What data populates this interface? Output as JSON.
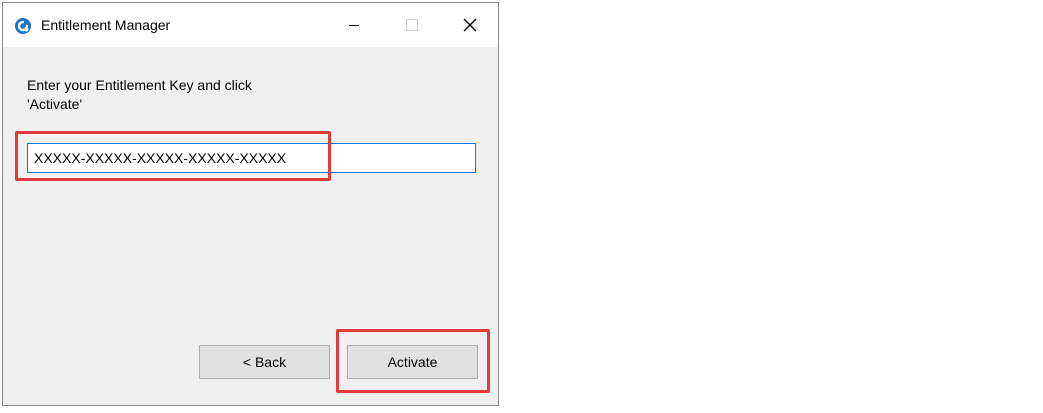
{
  "window": {
    "title": "Entitlement Manager",
    "app_icon": "entitlement-manager-app-icon",
    "controls": {
      "minimize_icon": "minimize-icon",
      "maximize_icon": "maximize-icon",
      "close_icon": "close-icon"
    }
  },
  "content": {
    "instruction": "Enter your Entitlement Key and click\n'Activate'",
    "key_field": {
      "value": "XXXXX-XXXXX-XXXXX-XXXXX-XXXXX",
      "placeholder": ""
    }
  },
  "buttons": {
    "back_label": "< Back",
    "activate_label": "Activate"
  },
  "colors": {
    "highlight": "#e23b3b",
    "input_border": "#0078d7",
    "window_bg": "#f0f0f0",
    "app_icon": "#1a73c9"
  }
}
